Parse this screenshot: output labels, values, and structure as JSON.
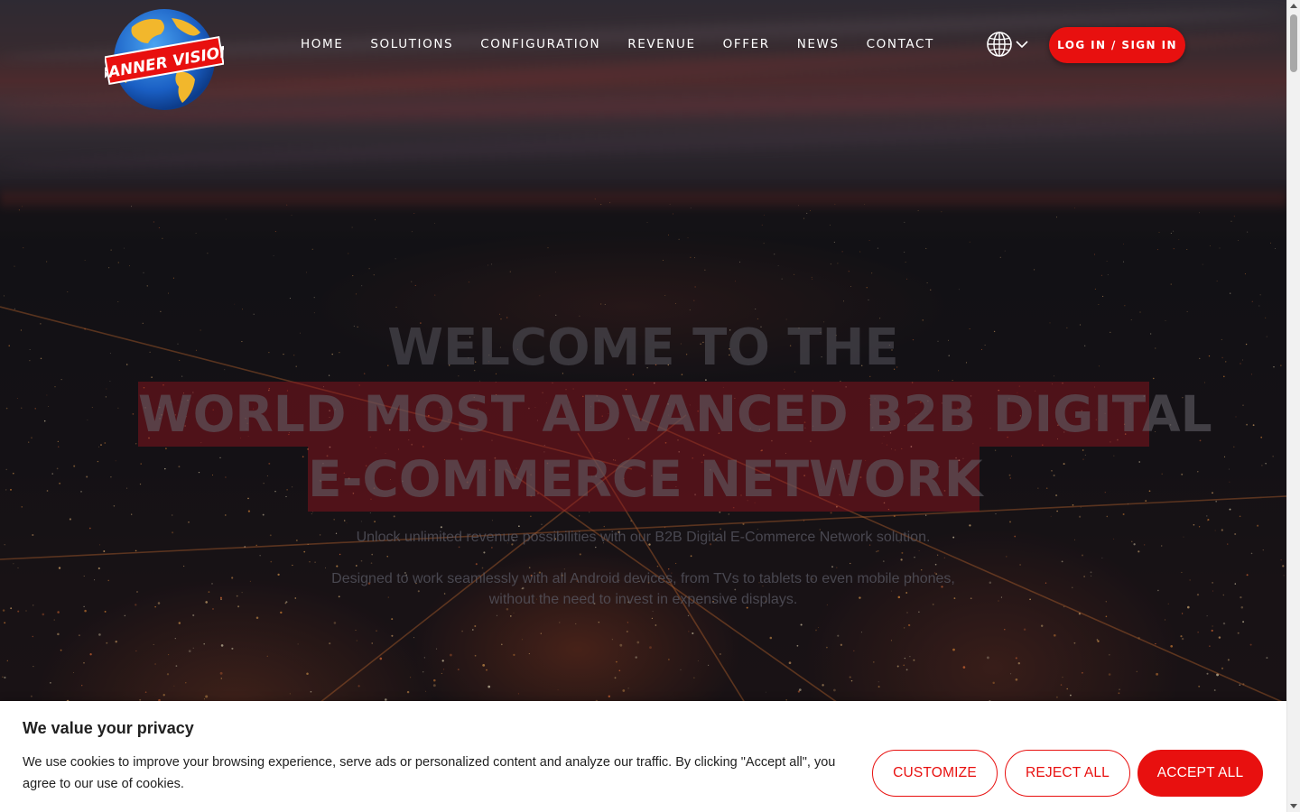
{
  "brand": {
    "logo_text": "BANNER VISION",
    "accent_color": "#e8100f"
  },
  "nav": {
    "items": [
      {
        "label": "HOME"
      },
      {
        "label": "SOLUTIONS"
      },
      {
        "label": "CONFIGURATION"
      },
      {
        "label": "REVENUE"
      },
      {
        "label": "OFFER"
      },
      {
        "label": "NEWS"
      },
      {
        "label": "CONTACT"
      }
    ],
    "language_icon": "globe-icon",
    "language_chevron": "chevron-down-icon",
    "login_label": "LOG IN / SIGN IN"
  },
  "hero": {
    "line1": "WELCOME TO THE",
    "line2": "WORLD MOST ADVANCED B2B DIGITAL",
    "line3": "E-COMMERCE NETWORK",
    "subtitle1": "Unlock unlimited revenue possibilities with our B2B Digital E-Commerce Network solution.",
    "subtitle2": "Designed to work seamlessly with all Android devices, from TVs to tablets to even mobile phones, without the need to invest in expensive displays."
  },
  "cookie": {
    "title": "We value your privacy",
    "text": "We use cookies to improve your browsing experience, serve ads or personalized content and analyze our traffic. By clicking \"Accept all\", you agree to our use of cookies.",
    "customize_label": "CUSTOMIZE",
    "reject_label": "REJECT ALL",
    "accept_label": "ACCEPT ALL"
  }
}
